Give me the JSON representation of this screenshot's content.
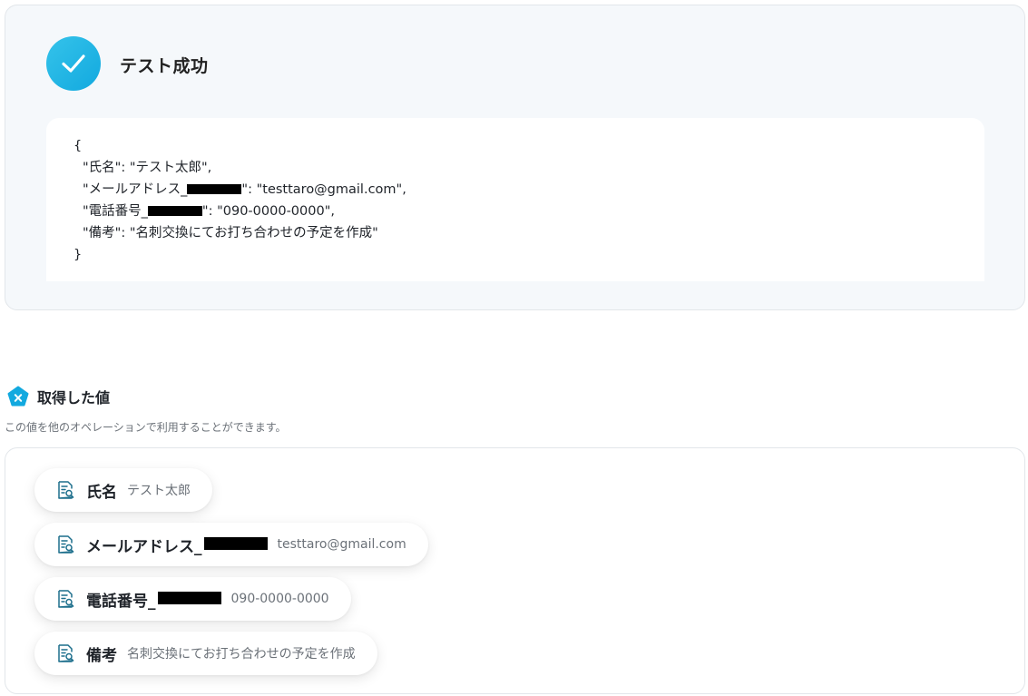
{
  "result": {
    "title": "テスト成功",
    "json_lines": {
      "open": "{",
      "name": "\"氏名\": \"テスト太郎\",",
      "email_key": "\"メールアドレス_",
      "email_rest": "\": \"testtaro@gmail.com\",",
      "phone_key": "\"電話番号_",
      "phone_rest": "\": \"090-0000-0000\",",
      "note": "\"備考\": \"名刺交換にてお打ち合わせの予定を作成\"",
      "close": "}"
    }
  },
  "acquired": {
    "title": "取得した値",
    "description": "この値を他のオペレーションで利用することができます。",
    "items": [
      {
        "label": "氏名",
        "value": "テスト太郎"
      },
      {
        "label": "メールアドレス_",
        "value": "testtaro@gmail.com"
      },
      {
        "label": "電話番号_",
        "value": "090-0000-0000"
      },
      {
        "label": "備考",
        "value": "名刺交換にてお打ち合わせの予定を作成"
      }
    ]
  },
  "colors": {
    "accent": "#12a9df",
    "icon_teal": "#1d6f8c",
    "redaction": "#000000"
  },
  "icons": {
    "success": "check-circle-icon",
    "acquired": "pentagon-x-icon",
    "value": "document-search-icon"
  }
}
